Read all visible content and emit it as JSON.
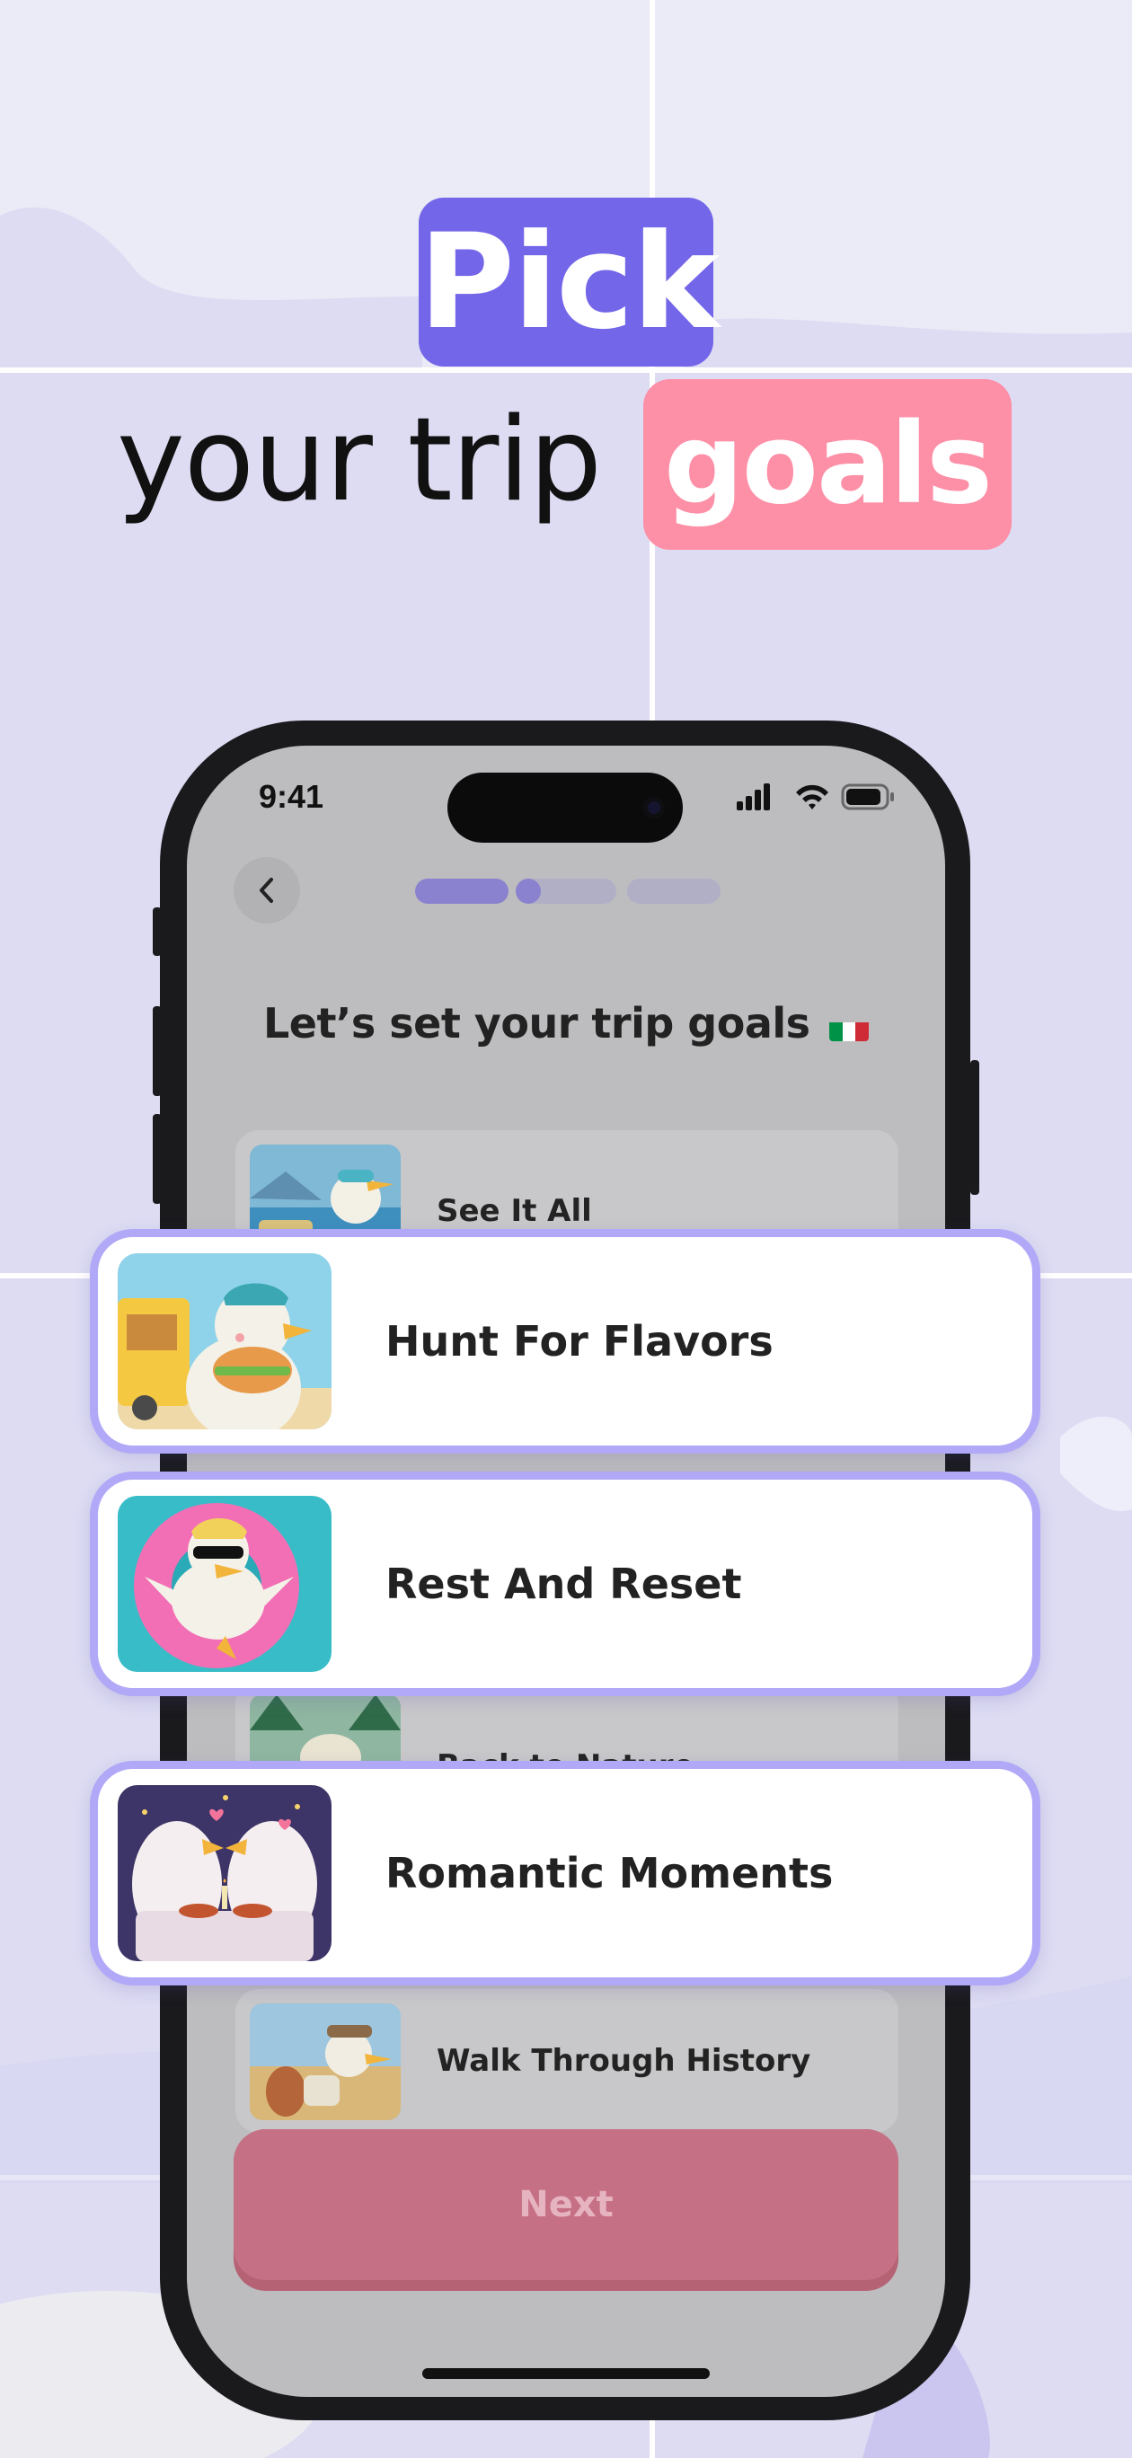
{
  "headline": {
    "word_badge": "Pick",
    "line2": "your trip",
    "word_badge2": "goals"
  },
  "status_bar": {
    "time": "9:41"
  },
  "screen": {
    "title": "Let’s set your trip goals",
    "progress": {
      "segments": 3,
      "current_step": 2
    },
    "options": [
      {
        "label": "See It All"
      },
      {
        "label": "Back to Nature"
      },
      {
        "label": "Walk Through History"
      }
    ],
    "next_label": "Next"
  },
  "highlighted_options": [
    {
      "label": "Hunt For Flavors"
    },
    {
      "label": "Rest And Reset"
    },
    {
      "label": "Romantic Moments"
    }
  ],
  "colors": {
    "purple_accent": "#7466e8",
    "pink_accent": "#fd8fa7",
    "card_border": "#b1a8f7",
    "next_button": "#c67085"
  }
}
